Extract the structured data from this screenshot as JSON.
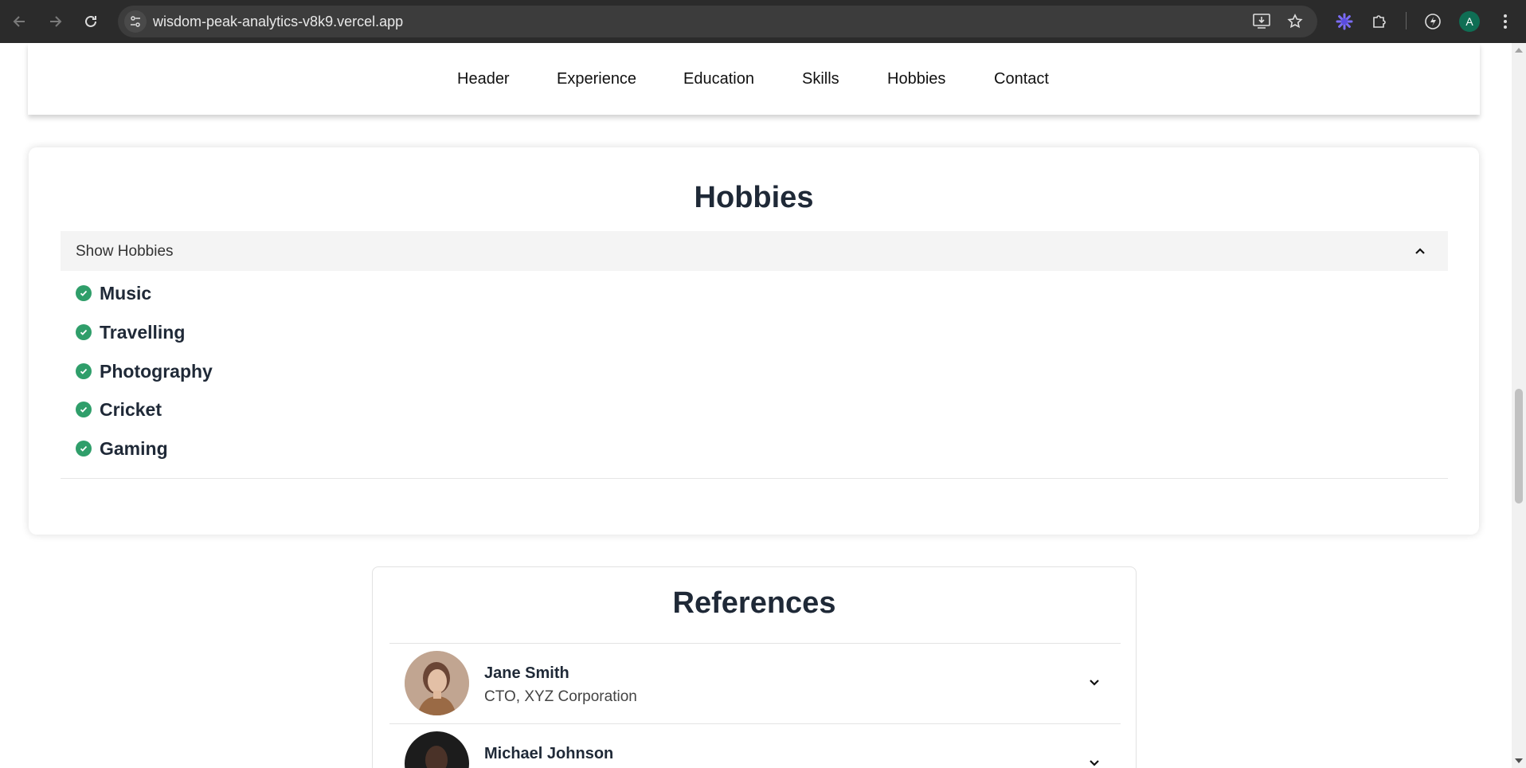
{
  "browser": {
    "url": "wisdom-peak-analytics-v8k9.vercel.app",
    "profile_initial": "A",
    "icons": [
      "back-icon",
      "forward-icon",
      "reload-icon",
      "site-settings-icon",
      "install-app-icon",
      "bookmark-star-icon",
      "extension-flower-icon",
      "extensions-puzzle-icon",
      "performance-icon",
      "profile-avatar",
      "menu-kebab-icon"
    ]
  },
  "nav": {
    "links": [
      "Header",
      "Experience",
      "Education",
      "Skills",
      "Hobbies",
      "Contact"
    ]
  },
  "hobbies": {
    "title": "Hobbies",
    "toggle_label": "Show Hobbies",
    "expanded": true,
    "items": [
      "Music",
      "Travelling",
      "Photography",
      "Cricket",
      "Gaming"
    ],
    "check_color": "#2f9e6a"
  },
  "references": {
    "title": "References",
    "items": [
      {
        "name": "Jane Smith",
        "role": "CTO, XYZ Corporation"
      },
      {
        "name": "Michael Johnson",
        "role": ""
      }
    ]
  }
}
